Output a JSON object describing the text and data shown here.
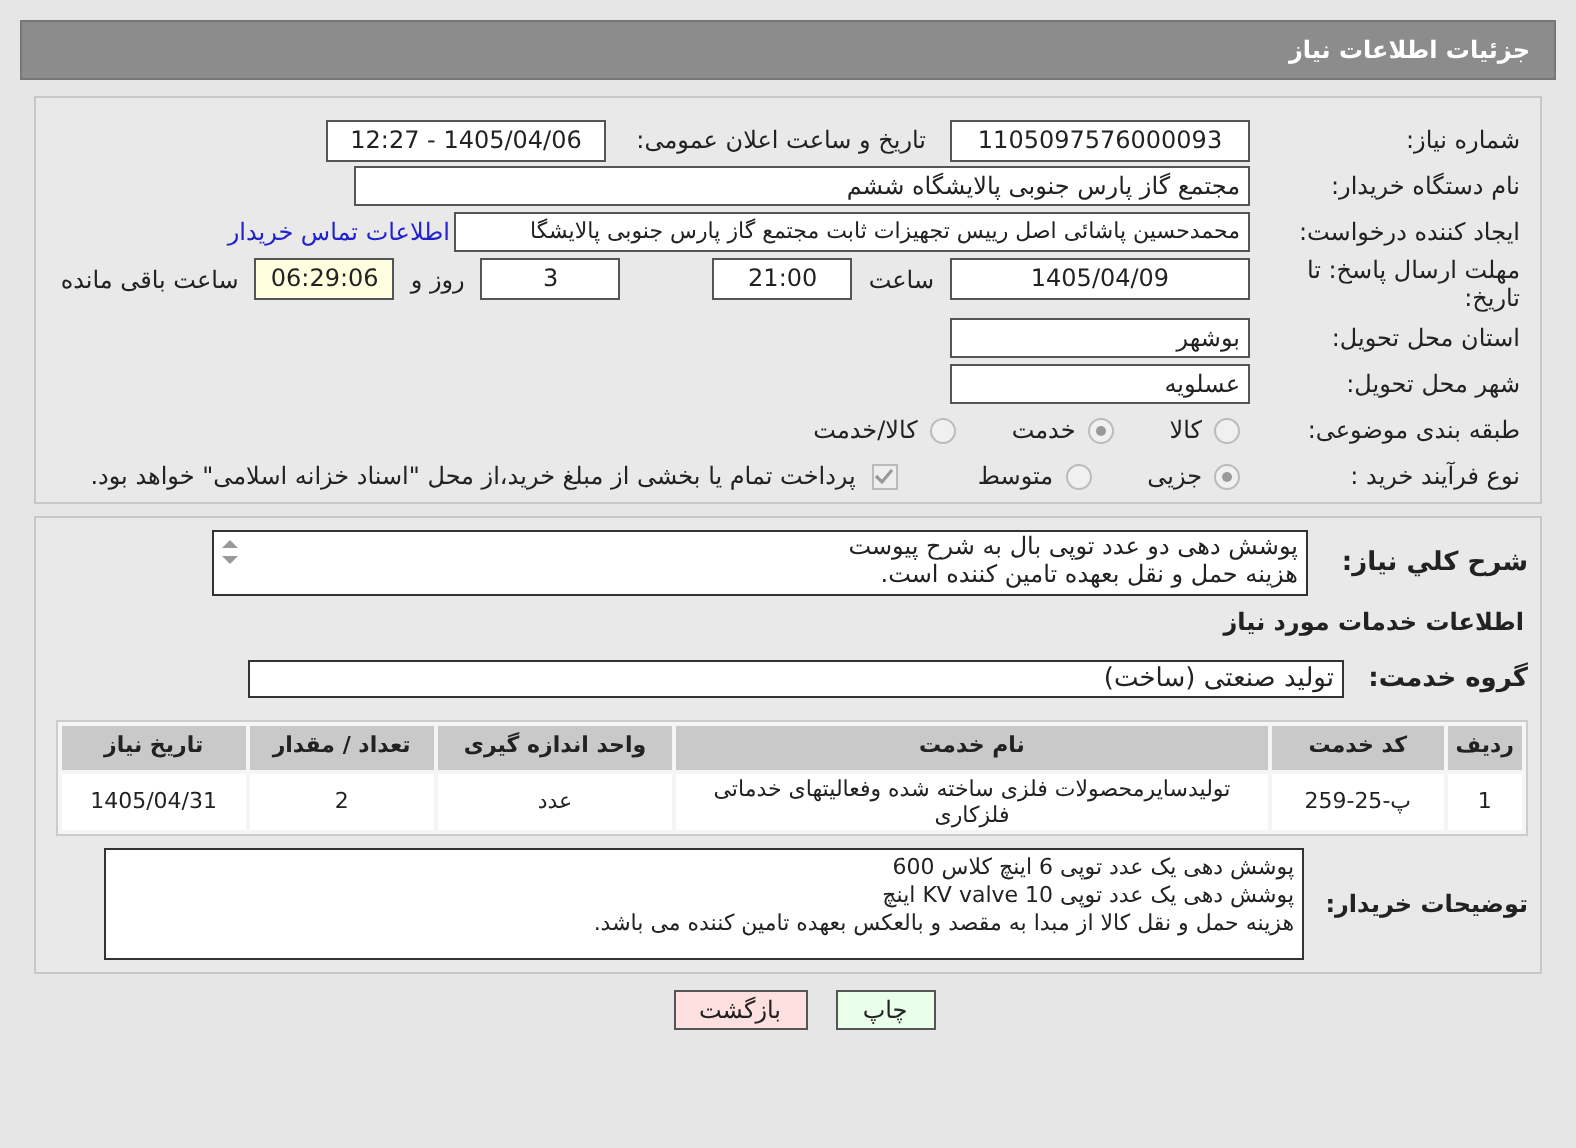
{
  "header": {
    "title": "جزئیات اطلاعات نیاز"
  },
  "need_number": {
    "label": "شماره نیاز:",
    "value": "1105097576000093"
  },
  "announce": {
    "label": "تاریخ و ساعت اعلان عمومی:",
    "value": "1405/04/06 - 12:27"
  },
  "buyer": {
    "label": "نام دستگاه خریدار:",
    "value": "مجتمع گاز پارس جنوبی  پالایشگاه ششم"
  },
  "requester": {
    "label": "ایجاد کننده درخواست:",
    "value": "محمدحسین پاشائی اصل رییس تجهیزات ثابت مجتمع گاز پارس جنوبی  پالایشگا",
    "link": "اطلاعات تماس خریدار"
  },
  "deadline": {
    "label": "مهلت ارسال پاسخ: تا تاریخ:",
    "date": "1405/04/09",
    "time_label": "ساعت",
    "time": "21:00",
    "days": "3",
    "days_label": "روز و",
    "remaining": "06:29:06",
    "remaining_label": "ساعت باقی مانده"
  },
  "province": {
    "label": "استان محل تحویل:",
    "value": "بوشهر"
  },
  "city": {
    "label": "شهر محل تحویل:",
    "value": "عسلویه"
  },
  "category": {
    "label": "طبقه بندی موضوعی:",
    "options": [
      {
        "label": "کالا",
        "selected": false
      },
      {
        "label": "خدمت",
        "selected": true
      },
      {
        "label": "کالا/خدمت",
        "selected": false
      }
    ]
  },
  "process": {
    "label": "نوع فرآیند خرید :",
    "options": [
      {
        "label": "جزیی",
        "selected": true
      },
      {
        "label": "متوسط",
        "selected": false
      }
    ],
    "checkbox": {
      "label": "پرداخت تمام یا بخشی از مبلغ خرید،از محل \"اسناد خزانه اسلامی\" خواهد بود.",
      "checked": true
    }
  },
  "description": {
    "label": "شرح کلي نياز:",
    "lines": [
      "پوشش دهی دو عدد توپی بال به شرح پیوست",
      "هزینه حمل و نقل بعهده تامین کننده است."
    ]
  },
  "services_title": "اطلاعات خدمات مورد نیاز",
  "service_group": {
    "label": "گروه خدمت:",
    "value": "تولید صنعتی (ساخت)"
  },
  "table": {
    "columns": [
      "ردیف",
      "کد خدمت",
      "نام خدمت",
      "واحد اندازه گیری",
      "تعداد / مقدار",
      "تاریخ نیاز"
    ],
    "rows": [
      [
        "1",
        "پ-25-259",
        "تولیدسایرمحصولات فلزی ساخته شده وفعالیتهای خدماتی فلزکاری",
        "عدد",
        "2",
        "1405/04/31"
      ]
    ]
  },
  "buyer_notes": {
    "label": "توضیحات خریدار:",
    "lines": [
      "پوشش دهی یک عدد توپی 6 اینچ کلاس 600",
      "پوشش دهی یک عدد توپی 10 KV valve اینچ",
      "هزینه حمل و نقل کالا از مبدا به مقصد و بالعکس بعهده تامین کننده می باشد."
    ]
  },
  "buttons": [
    {
      "label": "چاپ",
      "kind": "print"
    },
    {
      "label": "بازگشت",
      "kind": "back"
    }
  ]
}
